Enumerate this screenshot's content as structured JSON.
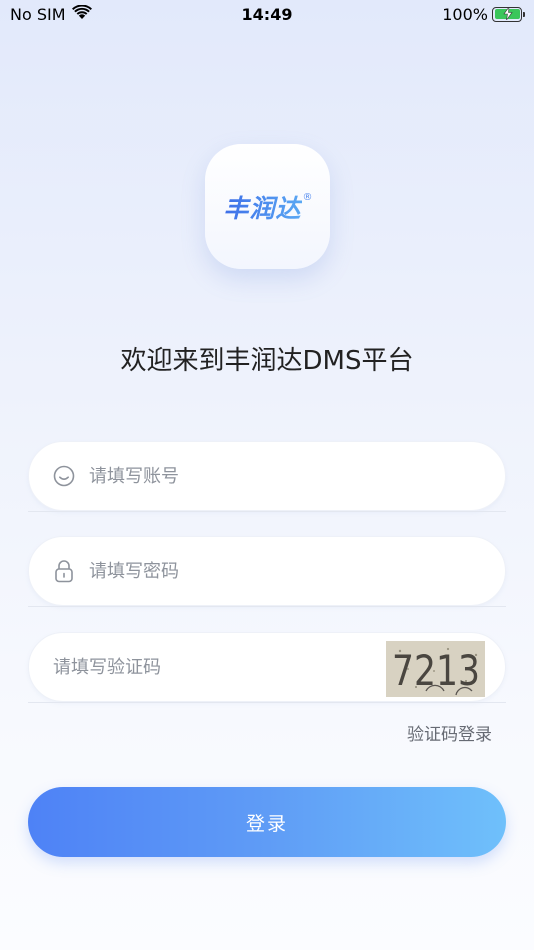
{
  "status_bar": {
    "carrier": "No SIM",
    "time": "14:49",
    "battery": "100%"
  },
  "logo": {
    "text": "丰润达",
    "registered": "®"
  },
  "welcome": "欢迎来到丰润达DMS平台",
  "form": {
    "account_placeholder": "请填写账号",
    "password_placeholder": "请填写密码",
    "captcha_placeholder": "请填写验证码",
    "captcha_image_text": "7213",
    "sms_login_label": "验证码登录",
    "login_button": "登录"
  },
  "colors": {
    "accent_start": "#4e82f6",
    "accent_end": "#6fc0fb",
    "battery": "#3bc65b"
  }
}
